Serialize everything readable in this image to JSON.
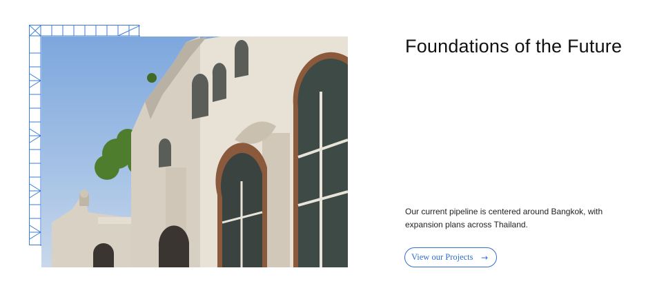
{
  "section": {
    "title": "Foundations of the Future",
    "description": "Our current pipeline is centered around Bangkok, with expansion plans across Thailand.",
    "cta": {
      "label": "View our Projects",
      "icon": "arrow-right-icon"
    }
  },
  "image": {
    "alt": "Historic European-style colonial building facade against blue sky in Bangkok"
  },
  "colors": {
    "accent": "#2f6fd0",
    "frame": "#3a7bd5",
    "text": "#111111",
    "background": "#ffffff"
  }
}
